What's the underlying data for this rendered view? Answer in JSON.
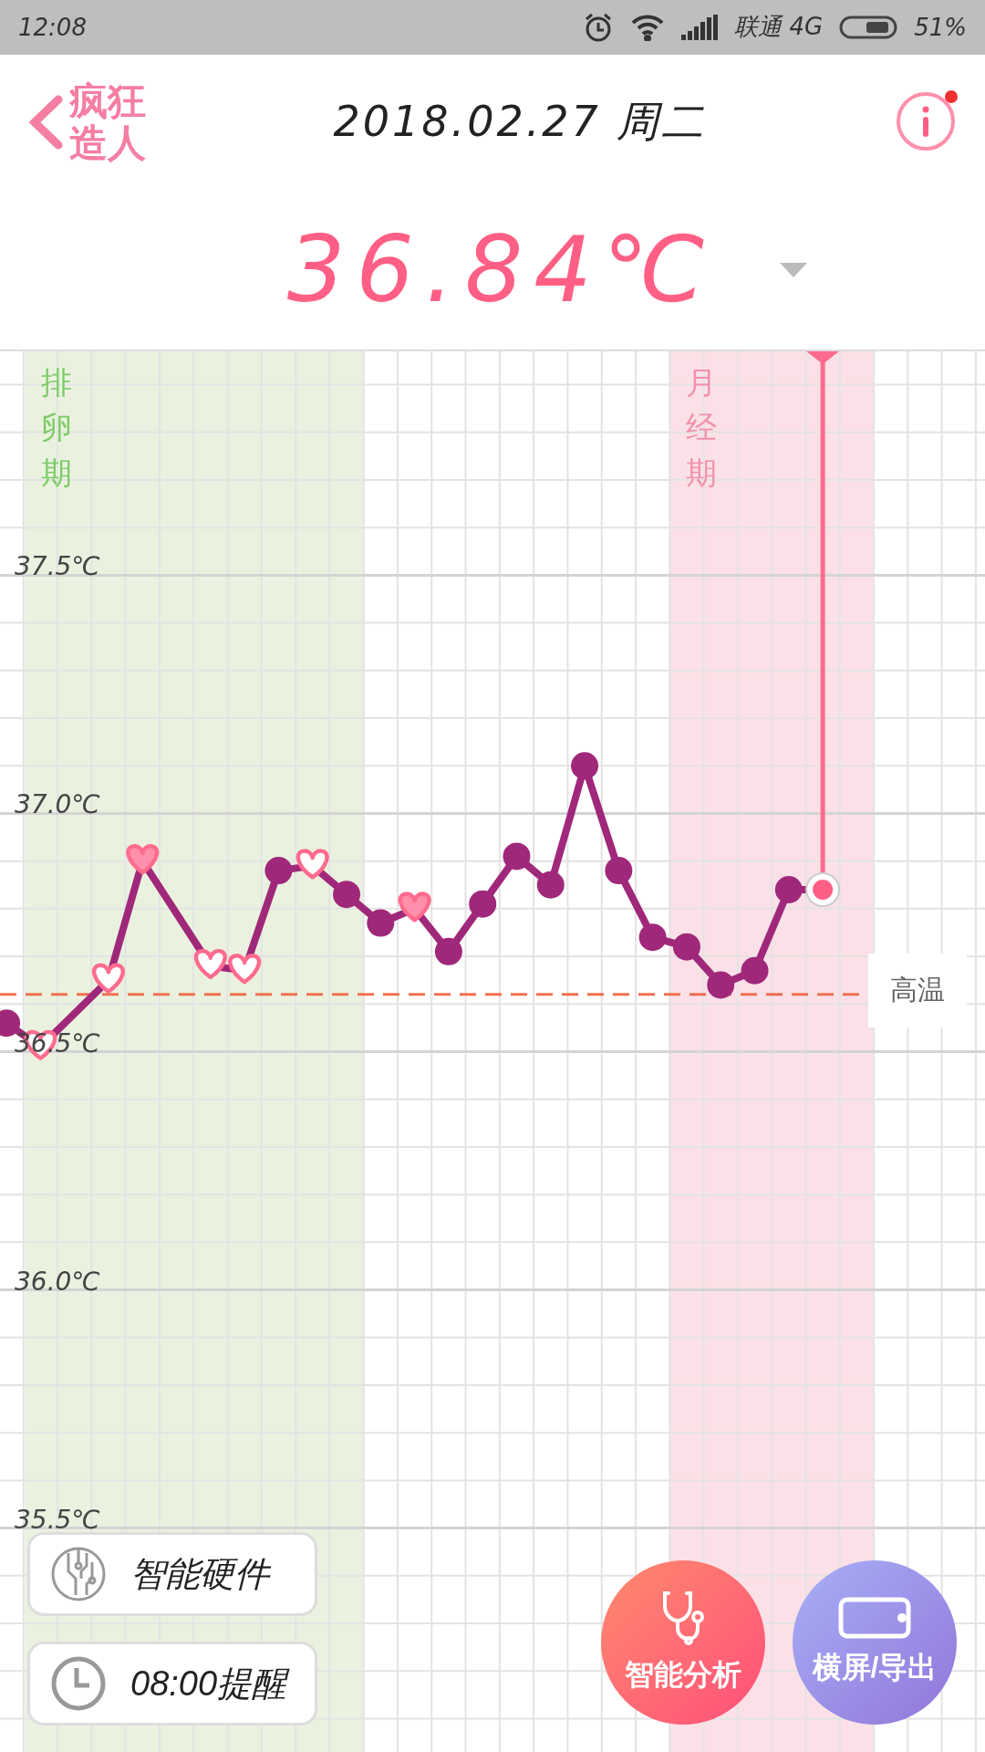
{
  "status_bar": {
    "time": "12:08",
    "carrier": "联通 4G",
    "battery": "51%"
  },
  "header": {
    "logo_lines": [
      "疯狂",
      "造人"
    ],
    "date": "2018.02.27 周二",
    "info_badge": true
  },
  "reading": {
    "value": "36.84℃"
  },
  "chart": {
    "points": [
      {
        "kind": "dot"
      },
      {
        "kind": "heart"
      },
      {
        "kind": "heart"
      },
      {
        "kind": "heart-filled"
      },
      {
        "kind": "heart"
      },
      {
        "kind": "heart"
      },
      {
        "kind": "dot"
      },
      {
        "kind": "heart"
      },
      {
        "kind": "dot"
      },
      {
        "kind": "dot"
      },
      {
        "kind": "heart-filled"
      },
      {
        "kind": "dot"
      },
      {
        "kind": "dot"
      },
      {
        "kind": "dot"
      },
      {
        "kind": "dot"
      },
      {
        "kind": "dot"
      },
      {
        "kind": "dot"
      },
      {
        "kind": "dot"
      },
      {
        "kind": "dot"
      },
      {
        "kind": "dot"
      },
      {
        "kind": "dot"
      },
      {
        "kind": "dot"
      },
      {
        "kind": "selected"
      }
    ],
    "bands": [
      {
        "label": "排卵期",
        "color": "#eaf2df"
      },
      {
        "label": "月经期",
        "color": "#fbe1e7"
      }
    ],
    "threshold_label": "高温",
    "chart_data": {
      "type": "line",
      "categories": [
        null,
        null,
        null,
        null,
        null,
        null,
        null,
        null,
        null,
        null,
        null,
        null,
        null,
        null,
        null,
        null,
        null,
        null,
        null,
        null,
        null,
        null,
        null,
        null,
        null
      ],
      "grid": true,
      "ref_lines": [
        {
          "axis": "y",
          "value": 36.62,
          "color": "#f07050"
        }
      ],
      "series": [
        {
          "color": "#a0287a",
          "marker": "circle",
          "values": [
            36.56,
            36.51,
            null,
            36.65,
            36.9,
            null,
            36.68,
            36.67,
            36.88,
            36.89,
            36.83,
            36.77,
            36.8,
            36.71,
            36.81,
            36.91,
            36.85,
            37.1,
            36.88,
            36.74,
            36.72,
            36.64,
            36.67,
            36.84,
            36.84
          ]
        }
      ],
      "ylim": [
        35.03,
        37.97
      ],
      "yticks": [
        {
          "value": 35.5,
          "label": "35.5℃"
        },
        {
          "value": 36.0,
          "label": "36.0℃"
        },
        {
          "value": 36.5,
          "label": "36.5℃"
        },
        {
          "value": 37.0,
          "label": "37.0℃"
        },
        {
          "value": 37.5,
          "label": "37.5℃"
        }
      ]
    }
  },
  "actions": [
    {
      "kind": "card",
      "label": "智能硬件"
    },
    {
      "kind": "card",
      "label": "08:00提醒"
    },
    {
      "kind": "circle",
      "label": "智能分析"
    },
    {
      "kind": "circle",
      "label": "横屏/导出"
    }
  ]
}
